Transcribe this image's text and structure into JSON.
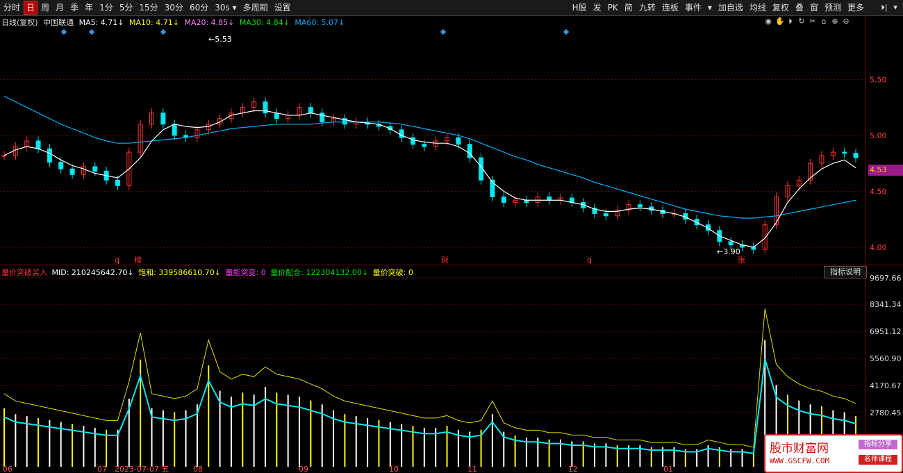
{
  "toolbar": {
    "left": [
      "分时",
      "日",
      "周",
      "月",
      "季",
      "年",
      "1分",
      "5分",
      "15分",
      "30分",
      "60分",
      "30s ▾",
      "多周期",
      "设置"
    ],
    "active": "日",
    "right": [
      "H股",
      "发",
      "PK",
      "简",
      "九转",
      "连板",
      "事件",
      "▾",
      "加自选",
      "均线",
      "复权",
      "叠",
      "窗",
      "预测",
      "更多"
    ],
    "end_icons": [
      "◂▸",
      "▾"
    ]
  },
  "legend1": {
    "title": "日线(复权)",
    "stock": "中国联通",
    "ma5": "MA5: 4.71↓",
    "ma10": "MA10: 4.71↓",
    "ma20": "MA20: 4.85↓",
    "ma30": "MA30: 4.84↓",
    "ma60": "MA60: 5.07↓"
  },
  "legend2": {
    "name": "量价突破买入",
    "mid": "MID: 210245642.70↓",
    "sat": "饱和: 339586610.70↓",
    "vol_break": "量能突变: 0",
    "vp_fit": "量价配合: 122304132.00↓",
    "vp_break": "量价突破: 0"
  },
  "explain_button": "指标说明",
  "price_badge": "4.53",
  "colors": {
    "up": "#ff3232",
    "down": "#00e8f0",
    "ma5": "#ffffff",
    "ma10": "#ffff00",
    "ma20": "#ff80ff",
    "ma30": "#00e000",
    "ma60": "#00b0ff",
    "grid": "#7a0000",
    "axis_text": "#ff4040"
  },
  "chart_data": [
    {
      "type": "line",
      "title": "日线(复权) 中国联通",
      "y_ticks": [
        "5.50",
        "5.00",
        "4.50",
        "4.00"
      ],
      "ylim": [
        3.85,
        5.95
      ],
      "annotations": {
        "high": "5.53",
        "low": "3.90"
      },
      "markers": [
        "q",
        "榜",
        "财",
        "q",
        "张"
      ],
      "note_series": "daily close approx",
      "close": [
        4.82,
        4.9,
        4.95,
        4.88,
        4.76,
        4.7,
        4.65,
        4.72,
        4.68,
        4.6,
        4.55,
        4.85,
        5.1,
        5.2,
        5.1,
        5.0,
        4.98,
        5.05,
        5.1,
        5.15,
        5.2,
        5.25,
        5.3,
        5.2,
        5.15,
        5.18,
        5.25,
        5.2,
        5.12,
        5.15,
        5.1,
        5.12,
        5.1,
        5.08,
        5.05,
        4.98,
        4.92,
        4.9,
        4.95,
        4.98,
        4.92,
        4.8,
        4.6,
        4.45,
        4.4,
        4.42,
        4.4,
        4.45,
        4.42,
        4.44,
        4.4,
        4.35,
        4.3,
        4.28,
        4.33,
        4.38,
        4.36,
        4.33,
        4.3,
        4.3,
        4.25,
        4.2,
        4.15,
        4.05,
        4.02,
        4.0,
        3.98,
        4.2,
        4.45,
        4.55,
        4.6,
        4.75,
        4.82,
        4.85,
        4.84,
        4.8
      ],
      "ma5": [
        4.82,
        4.87,
        4.9,
        4.88,
        4.84,
        4.78,
        4.73,
        4.7,
        4.66,
        4.64,
        4.62,
        4.7,
        4.8,
        4.95,
        5.05,
        5.1,
        5.08,
        5.07,
        5.08,
        5.12,
        5.18,
        5.2,
        5.22,
        5.22,
        5.2,
        5.18,
        5.18,
        5.2,
        5.18,
        5.16,
        5.14,
        5.12,
        5.11,
        5.1,
        5.06,
        5.0,
        4.96,
        4.94,
        4.93,
        4.93,
        4.9,
        4.84,
        4.72,
        4.58,
        4.5,
        4.44,
        4.42,
        4.42,
        4.42,
        4.42,
        4.4,
        4.38,
        4.34,
        4.32,
        4.32,
        4.34,
        4.35,
        4.34,
        4.32,
        4.3,
        4.27,
        4.22,
        4.17,
        4.1,
        4.06,
        4.02,
        4.0,
        4.08,
        4.22,
        4.4,
        4.52,
        4.62,
        4.7,
        4.75,
        4.78,
        4.71
      ],
      "ma60": [
        5.35,
        5.3,
        5.25,
        5.2,
        5.15,
        5.1,
        5.06,
        5.02,
        4.98,
        4.95,
        4.93,
        4.93,
        4.94,
        4.95,
        4.96,
        4.97,
        4.98,
        5.0,
        5.02,
        5.04,
        5.06,
        5.07,
        5.08,
        5.09,
        5.1,
        5.1,
        5.1,
        5.1,
        5.11,
        5.12,
        5.12,
        5.12,
        5.12,
        5.12,
        5.11,
        5.1,
        5.08,
        5.06,
        5.04,
        5.02,
        5.0,
        4.97,
        4.93,
        4.89,
        4.85,
        4.81,
        4.78,
        4.74,
        4.71,
        4.68,
        4.65,
        4.62,
        4.58,
        4.55,
        4.52,
        4.49,
        4.46,
        4.43,
        4.4,
        4.37,
        4.34,
        4.32,
        4.3,
        4.28,
        4.27,
        4.26,
        4.26,
        4.27,
        4.28,
        4.3,
        4.32,
        4.34,
        4.36,
        4.38,
        4.4,
        4.42
      ]
    },
    {
      "type": "bar",
      "title": "量价突破买入",
      "y_ticks": [
        "9697.66",
        "8341.34",
        "6951.12",
        "5560.90",
        "4170.67",
        "2780.45"
      ],
      "ylim": [
        0,
        9697.66
      ],
      "x_ticks": [
        "06",
        "07",
        "2023-07-07 五",
        "08",
        "09",
        "10",
        "11",
        "12",
        "01"
      ],
      "volume": [
        3000,
        2700,
        2600,
        2500,
        2400,
        2300,
        2200,
        2100,
        2000,
        1900,
        1900,
        3500,
        5500,
        3000,
        2900,
        2800,
        2900,
        3200,
        5200,
        3900,
        3600,
        3800,
        3700,
        4100,
        3800,
        3700,
        3600,
        3400,
        3200,
        2900,
        2700,
        2600,
        2500,
        2400,
        2300,
        2200,
        2100,
        2000,
        2000,
        2100,
        1900,
        1800,
        1900,
        2700,
        1800,
        1600,
        1500,
        1500,
        1400,
        1400,
        1300,
        1300,
        1200,
        1200,
        1100,
        1100,
        1100,
        1000,
        1000,
        1000,
        900,
        900,
        1100,
        1000,
        900,
        900,
        800,
        6500,
        4200,
        3700,
        3400,
        3200,
        3100,
        2900,
        2800,
        2600
      ]
    }
  ]
}
